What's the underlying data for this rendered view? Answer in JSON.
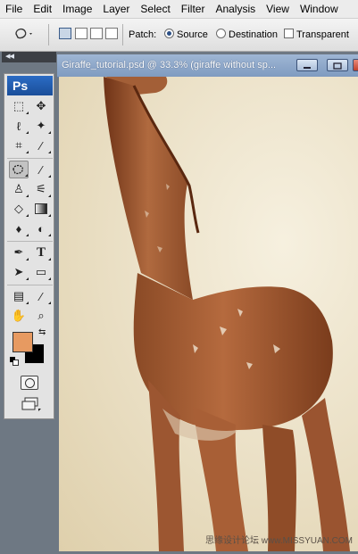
{
  "menu": [
    "File",
    "Edit",
    "Image",
    "Layer",
    "Select",
    "Filter",
    "Analysis",
    "View",
    "Window"
  ],
  "options": {
    "patch_label": "Patch:",
    "source_label": "Source",
    "destination_label": "Destination",
    "transparent_label": "Transparent",
    "selected_mode": "Source"
  },
  "toolbox": {
    "logo": "Ps",
    "collapse_arrows": "◂◂",
    "tools": [
      {
        "name": "marquee-icon",
        "glyph": "⬚"
      },
      {
        "name": "move-icon",
        "glyph": "✥"
      },
      {
        "name": "lasso-icon",
        "glyph": "ℓ"
      },
      {
        "name": "magic-wand-icon",
        "glyph": "✦"
      },
      {
        "name": "crop-icon",
        "glyph": "⌗"
      },
      {
        "name": "eyedropper-icon",
        "glyph": "⁄"
      },
      {
        "name": "patch-icon",
        "glyph": "⚙"
      },
      {
        "name": "brush-icon",
        "glyph": "⁄"
      },
      {
        "name": "clone-stamp-icon",
        "glyph": "♙"
      },
      {
        "name": "history-brush-icon",
        "glyph": "⚟"
      },
      {
        "name": "eraser-icon",
        "glyph": "◇"
      },
      {
        "name": "gradient-icon",
        "glyph": "■"
      },
      {
        "name": "blur-icon",
        "glyph": "♦"
      },
      {
        "name": "dodge-icon",
        "glyph": "◐"
      },
      {
        "name": "pen-icon",
        "glyph": "✒"
      },
      {
        "name": "type-icon",
        "glyph": "T"
      },
      {
        "name": "path-selection-icon",
        "glyph": "➤"
      },
      {
        "name": "shape-icon",
        "glyph": "▭"
      },
      {
        "name": "notes-icon",
        "glyph": "▤"
      },
      {
        "name": "eyedropper-color-icon",
        "glyph": "⁄"
      },
      {
        "name": "hand-icon",
        "glyph": "✋"
      },
      {
        "name": "zoom-icon",
        "glyph": "⌕"
      }
    ],
    "foreground_color": "#e79a61",
    "background_color": "#000000"
  },
  "document": {
    "title": "Giraffe_tutorial.psd @ 33.3% (giraffe without sp..."
  },
  "watermark": "思缘设计论坛 www.MISSYUAN.COM"
}
